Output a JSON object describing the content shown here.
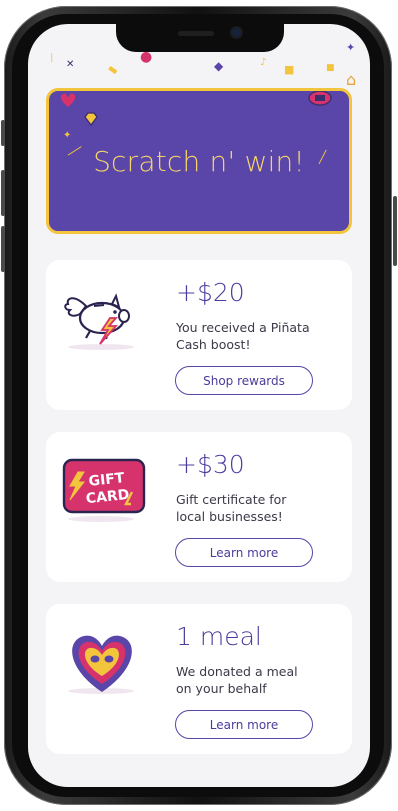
{
  "banner": {
    "title": "Scratch n' win!"
  },
  "rewards": [
    {
      "amount": "+$20",
      "description": "You received a Piñata\nCash boost!",
      "button_label": "Shop rewards",
      "icon": "flying-piggy-bank-icon"
    },
    {
      "amount": "+$30",
      "description": "Gift certificate for\nlocal businesses!",
      "button_label": "Learn more",
      "icon": "gift-card-icon",
      "icon_text_line1": "GIFT",
      "icon_text_line2": "CARD"
    },
    {
      "amount": "1 meal",
      "description": "We donated a meal\non your behalf",
      "button_label": "Learn more",
      "icon": "heart-face-icon"
    }
  ],
  "colors": {
    "brand_purple": "#5a45a8",
    "banner_border": "#f2c53d",
    "banner_text": "#f4d469",
    "accent_pink": "#d6336c",
    "screen_bg": "#f4f3f6"
  }
}
